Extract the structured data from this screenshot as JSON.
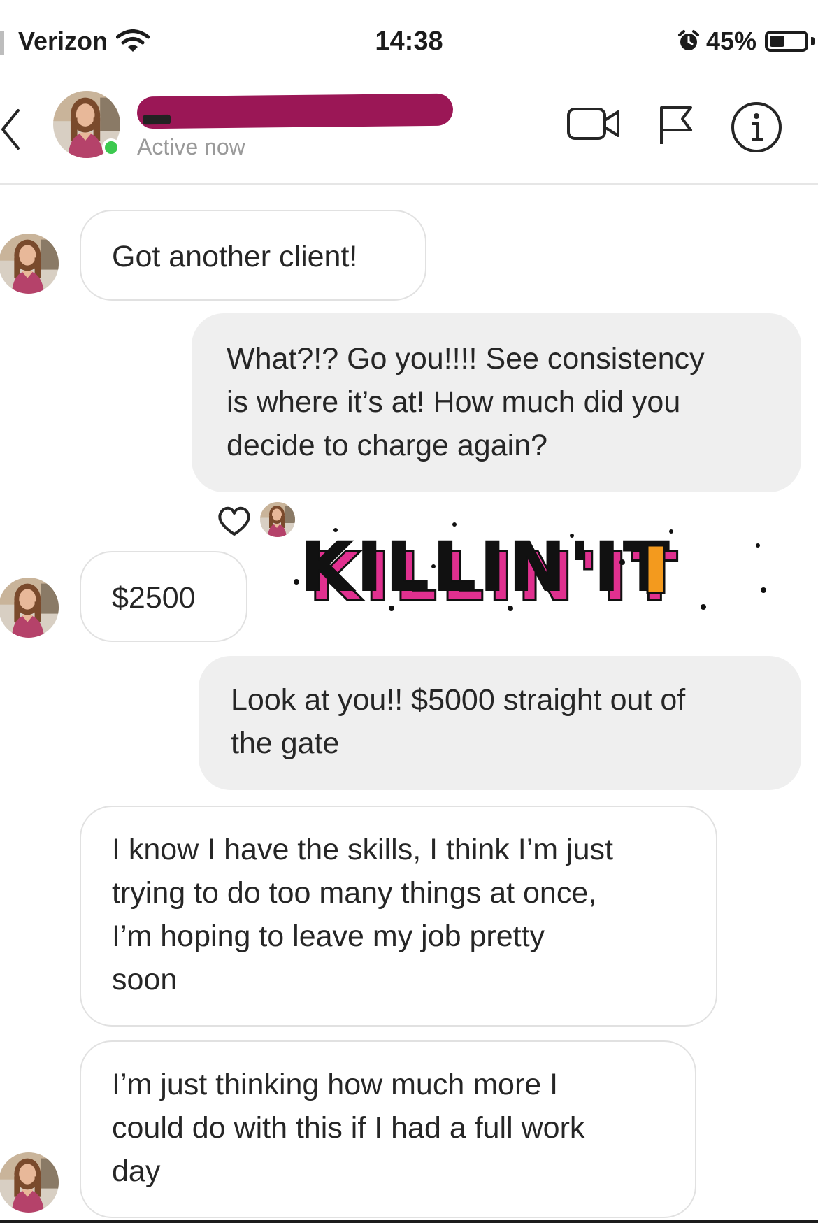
{
  "status_bar": {
    "carrier": "Verizon",
    "time": "14:38",
    "battery_percent": "45%",
    "battery_level": 0.45,
    "icons": [
      "wifi-icon",
      "alarm-icon",
      "battery-icon"
    ]
  },
  "header": {
    "status": "Active now",
    "icons": [
      "back-chevron-icon",
      "video-call-icon",
      "flag-icon",
      "info-icon"
    ]
  },
  "messages": [
    {
      "from": "them",
      "text": "Got another client!"
    },
    {
      "from": "me",
      "lines": [
        "What?!? Go you!!!! See consistency",
        "is where it’s at! How much did you",
        "decide to charge again?"
      ]
    },
    {
      "from": "them",
      "text": "$2500"
    },
    {
      "from": "them",
      "type": "sticker",
      "text": "KILLIN'IT"
    },
    {
      "from": "me",
      "lines": [
        "Look at you!! $5000 straight out of",
        "the gate"
      ]
    },
    {
      "from": "them",
      "lines": [
        "I know I have the skills, I think I’m just",
        "trying to do too many things at once,",
        "I’m hoping to leave my job pretty",
        "soon"
      ]
    },
    {
      "from": "them",
      "lines": [
        "I’m just thinking how much more I",
        "could do with this if I had a full work",
        "day"
      ]
    }
  ],
  "colors": {
    "sent_bubble": "#efefef",
    "received_border": "#e1e1e1",
    "online_dot": "#3cc94f",
    "redaction": "#9b1756",
    "sticker_pink": "#e0308f",
    "sticker_orange": "#f39a1e"
  }
}
